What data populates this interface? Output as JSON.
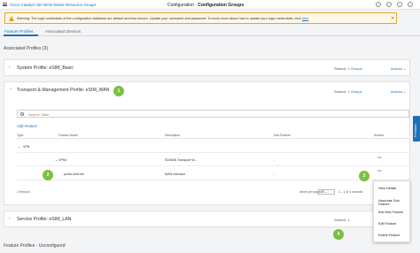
{
  "header": {
    "brand": "Cisco Catalyst SD-WAN",
    "resource_group": "Select Resource Group•",
    "breadcrumb_section": "Configuration",
    "breadcrumb_separator": "·",
    "breadcrumb_page": "Configuration Groups"
  },
  "warning": {
    "text": "Warning: The login credentials of the configuration database are default and less secure. Update your username and password. To know more about how to update your login credentials, click",
    "link": "here"
  },
  "tabs": [
    {
      "label": "Feature Profiles",
      "active": true
    },
    {
      "label": "Associated Devices",
      "active": false
    }
  ],
  "associated_title": "Associated Profiles (3)",
  "profiles": [
    {
      "name": "System Profile: eSIM_Basic",
      "shared_count": "1",
      "shared_label": "Groups",
      "actions": "Actions"
    },
    {
      "name": "Transport & Management Profile: eSIM_WAN",
      "shared_count": "1",
      "shared_label": "Groups",
      "actions": "Actions"
    },
    {
      "name": "Service Profile: eSIM_LAN",
      "shared_count": "1",
      "shared_label": "Groups",
      "actions": "Actions"
    }
  ],
  "shared_prefix": "Shared:",
  "table": {
    "search_placeholder": "Search Table",
    "add_feature": "Add Feature",
    "columns": [
      "Type",
      "Feature Name",
      "Description",
      "Sub-Feature",
      "Actions"
    ],
    "group_label": "VPN",
    "rows": [
      {
        "type": "VPN",
        "name": "VPN0",
        "description": "SDWAN Transport W...",
        "sub": "-"
      },
      {
        "type": "",
        "name": "public-internet",
        "description": "WAN Interface",
        "sub": "-"
      }
    ],
    "footer_count": "1 Record",
    "items_per_page_label": "Items per page:",
    "items_per_page_value": "25",
    "range": "1 - 1 of 1 records",
    "page": "1 of 1 pages"
  },
  "context_menu": [
    "View Details",
    "Associate Sub-Feature",
    "Add Sub-Feature",
    "Edit Feature",
    "Delete Feature"
  ],
  "callouts": [
    "1",
    "2",
    "3",
    "4"
  ],
  "feedback": "Feedback",
  "unconfigured_title": "Feature Profiles - Unconfigured",
  "colors": {
    "accent": "#1e6fb8",
    "callout": "#7cc041",
    "warning_border": "#f0a41f"
  }
}
